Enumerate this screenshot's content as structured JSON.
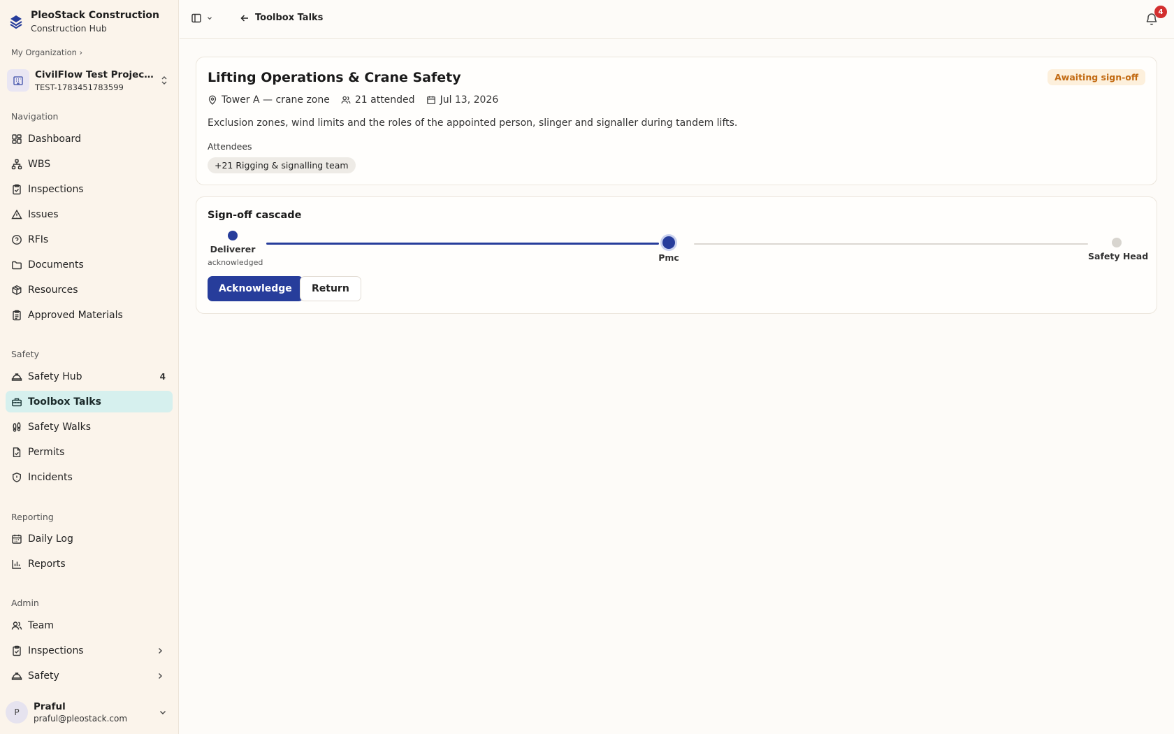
{
  "brand": {
    "name": "PleoStack Construction",
    "subtitle": "Construction Hub"
  },
  "org": {
    "breadcrumb": "My Organization ›"
  },
  "project": {
    "name": "CivilFlow Test Project (U...",
    "code": "TEST-1783451783599"
  },
  "sections": {
    "navigation": "Navigation",
    "safety": "Safety",
    "reporting": "Reporting",
    "admin": "Admin"
  },
  "nav": {
    "dashboard": "Dashboard",
    "wbs": "WBS",
    "inspections": "Inspections",
    "issues": "Issues",
    "rfis": "RFIs",
    "documents": "Documents",
    "resources": "Resources",
    "approved_materials": "Approved Materials"
  },
  "safety_nav": {
    "safety_hub": "Safety Hub",
    "safety_hub_count": "4",
    "toolbox_talks": "Toolbox Talks",
    "safety_walks": "Safety Walks",
    "permits": "Permits",
    "incidents": "Incidents"
  },
  "reporting_nav": {
    "daily_log": "Daily Log",
    "reports": "Reports"
  },
  "admin_nav": {
    "team": "Team",
    "inspections": "Inspections",
    "safety": "Safety"
  },
  "user": {
    "initial": "P",
    "name": "Praful",
    "email": "praful@pleostack.com"
  },
  "header": {
    "back_label": "Toolbox Talks",
    "notification_count": "4"
  },
  "talk": {
    "title": "Lifting Operations & Crane Safety",
    "status": "Awaiting sign-off",
    "location": "Tower A — crane zone",
    "attended": "21 attended",
    "date": "Jul 13, 2026",
    "description": "Exclusion zones, wind limits and the roles of the appointed person, slinger and signaller during tandem lifts.",
    "attendees_label": "Attendees",
    "attendee_chip": "+21 Rigging & signalling team"
  },
  "signoff": {
    "title": "Sign-off cascade",
    "steps": [
      {
        "label": "Deliverer",
        "sub": "acknowledged"
      },
      {
        "label": "Pmc"
      },
      {
        "label": "Safety Head"
      }
    ],
    "acknowledge_label": "Acknowledge",
    "return_label": "Return"
  },
  "colors": {
    "accent": "#273d9b",
    "active_bg": "#d6f0ee",
    "status_fg": "#c26a12",
    "badge": "#d32f2f"
  }
}
